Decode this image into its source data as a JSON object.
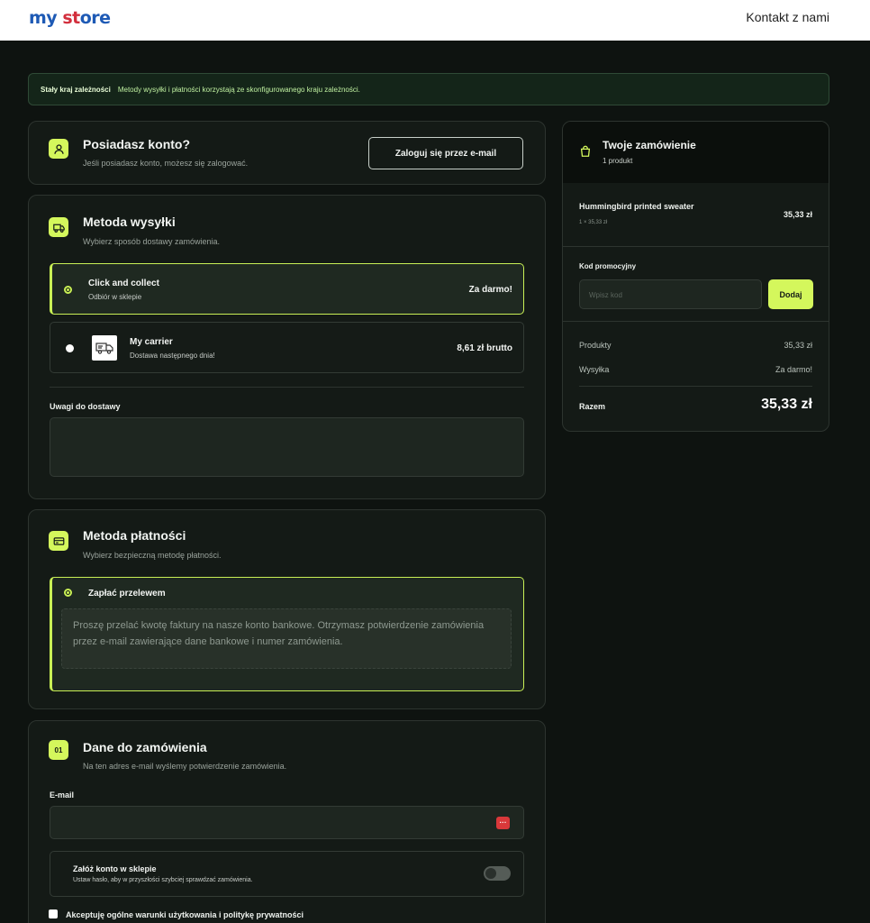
{
  "header": {
    "logo_part1": "my",
    "logo_part2": "st",
    "logo_part3": "ore",
    "contact_link": "Kontakt z nami"
  },
  "notice": {
    "title": "Stały kraj zależności",
    "text": "Metody wysyłki i płatności korzystają ze skonfigurowanego kraju zależności."
  },
  "account": {
    "title": "Posiadasz konto?",
    "subtitle": "Jeśli posiadasz konto, możesz się zalogować.",
    "login_button": "Zaloguj się przez e-mail",
    "icon": "user-icon"
  },
  "shipping": {
    "title": "Metoda wysyłki",
    "subtitle": "Wybierz sposób dostawy zamówienia.",
    "icon": "truck-icon",
    "options": [
      {
        "name": "Click and collect",
        "desc": "Odbiór w sklepie",
        "price": "Za darmo!",
        "selected": true
      },
      {
        "name": "My carrier",
        "desc": "Dostawa następnego dnia!",
        "price": "8,61 zł brutto",
        "selected": false
      }
    ],
    "notes_label": "Uwagi do dostawy"
  },
  "payment": {
    "title": "Metoda płatności",
    "subtitle": "Wybierz bezpieczną metodę płatności.",
    "icon": "credit-card-icon",
    "option_name": "Zapłać przelewem",
    "option_desc": "Proszę przelać kwotę faktury na nasze konto bankowe. Otrzymasz potwierdzenie zamówienia przez e-mail zawierające dane bankowe i numer zamówienia."
  },
  "order_details": {
    "step": "01",
    "title": "Dane do zamówienia",
    "subtitle": "Na ten adres e-mail wyślemy potwierdzenie zamówienia.",
    "email_label": "E-mail",
    "create_account_title": "Załóż konto w sklepie",
    "create_account_desc": "Ustaw hasło, aby w przyszłości szybciej sprawdzać zamówienia.",
    "terms_label": "Akceptuję ogólne warunki użytkowania i politykę prywatności"
  },
  "summary": {
    "title": "Twoje zamówienie",
    "count": "1 produkt",
    "icon": "shopping-bag-icon",
    "product_name": "Hummingbird printed sweater",
    "product_qty": "1 × 35,33 zł",
    "product_price": "35,33 zł",
    "promo_label": "Kod promocyjny",
    "promo_placeholder": "Wpisz kod",
    "promo_button": "Dodaj",
    "products_label": "Produkty",
    "products_value": "35,33 zł",
    "shipping_label": "Wysyłka",
    "shipping_value": "Za darmo!",
    "total_label": "Razem",
    "total_value": "35,33 zł"
  },
  "colors": {
    "accent": "#d4f75c",
    "background": "#0e1310",
    "card": "#141a16"
  }
}
